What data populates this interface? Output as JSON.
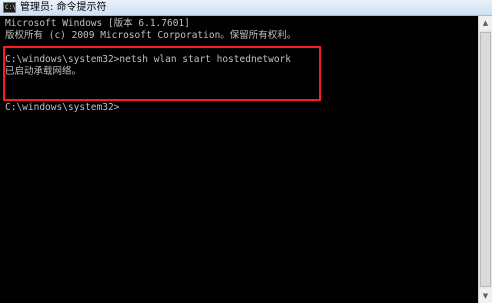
{
  "window": {
    "title": "管理员: 命令提示符",
    "icon_label": "C:\\"
  },
  "console": {
    "lines": [
      "Microsoft Windows [版本 6.1.7601]",
      "版权所有 (c) 2009 Microsoft Corporation。保留所有权利。",
      "",
      "C:\\windows\\system32>netsh wlan start hostednetwork",
      "已启动承载网络。",
      "",
      "C:\\windows\\system32>"
    ]
  },
  "scrollbar": {
    "up_glyph": "▲",
    "down_glyph": "▼"
  },
  "colors": {
    "console_bg": "#000000",
    "console_text": "#c0c0c0",
    "highlight": "#ff1b1b"
  }
}
